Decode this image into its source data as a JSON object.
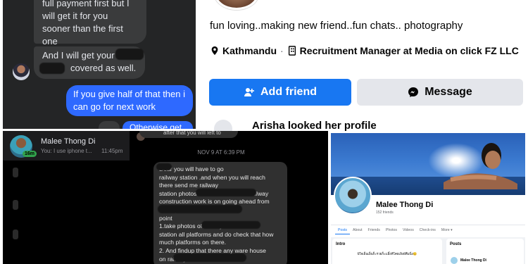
{
  "chat_top": {
    "incoming_1": "full payment first but I will get it for you sooner than the first one",
    "incoming_2_a": "And I will get your",
    "incoming_2_b": "covered as well.",
    "outgoing_1": "If you give half of that then i can go for next work",
    "outgoing_2": "Otherwise get"
  },
  "profile": {
    "bio": "fun loving..making new friend..fun chats.. photography",
    "location": "Kathmandu",
    "work": "Recruitment Manager at Media on click FZ LLC",
    "add_friend_label": "Add friend",
    "message_label": "Message",
    "looked_text": "Arisha looked her profile"
  },
  "chat_list": {
    "contact_name": "Malee Thong Di",
    "last_message": "You: I use iphone t...",
    "time": "11:45pm",
    "online_badge": "16m"
  },
  "conversation": {
    "previous_message": "after that you will left to",
    "date_stamp": "NOV 9 AT 6:39 PM",
    "lines": [
      "Dear   you will have to go",
      "railway station .and when you will reach",
      "there send me                              railway",
      "station photos and will check that railway",
      "construction  work is on going  ahead from",
      "                            railway station. Do it",
      "point",
      "1.take photos of                              railway",
      "station all platforms and do check that how",
      "much platforms on there.",
      "2.   And findup that there any ware house",
      "        on                                        railway"
    ]
  },
  "profile_light": {
    "name": "Malee Thong Di",
    "friends": "152 friends",
    "tabs": [
      "Posts",
      "About",
      "Friends",
      "Photos",
      "Videos",
      "Check-ins",
      "More ▾"
    ],
    "intro_title": "Intro",
    "intro_text": "ปัใจเย็นเย็นก็ะรวยก็ะเเอิ้งทีโคยเลิงยัคึมนิ่ง😊",
    "posts_title": "Posts",
    "post_author": "Malee Thong Di"
  },
  "colors": {
    "fb_blue": "#1877f2",
    "messenger_blue": "#2e69ff",
    "dark_bg": "#242526",
    "online_green": "#31a24c"
  },
  "icons": [
    "location-pin-icon",
    "briefcase-icon",
    "add-friend-icon",
    "messenger-icon"
  ]
}
